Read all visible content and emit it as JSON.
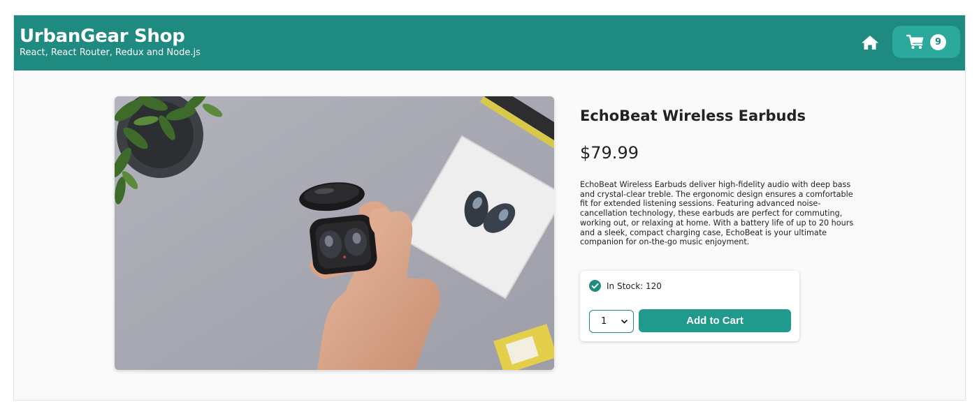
{
  "header": {
    "title": "UrbanGear Shop",
    "subtitle": "React, React Router, Redux and Node.js",
    "home_icon": "home-icon",
    "cart_icon": "cart-icon",
    "cart_count": "9",
    "brand_color": "#1f8a80",
    "cart_button_color": "#2aa99c"
  },
  "product": {
    "image_alt": "EchoBeat Wireless Earbuds",
    "name": "EchoBeat Wireless Earbuds",
    "price": "$79.99",
    "description": "EchoBeat Wireless Earbuds deliver high-fidelity audio with deep bass and crystal-clear treble. The ergonomic design ensures a comfortable fit for extended listening sessions. Featuring advanced noise-cancellation technology, these earbuds are perfect for commuting, working out, or relaxing at home. With a battery life of up to 20 hours and a sleek, compact charging case, EchoBeat is your ultimate companion for on-the-go music enjoyment."
  },
  "purchase": {
    "stock_icon": "check-circle-icon",
    "stock_text": "In Stock: 120",
    "quantity_selected": "1",
    "add_to_cart_label": "Add to Cart",
    "accent_color": "#1f9a8c"
  }
}
